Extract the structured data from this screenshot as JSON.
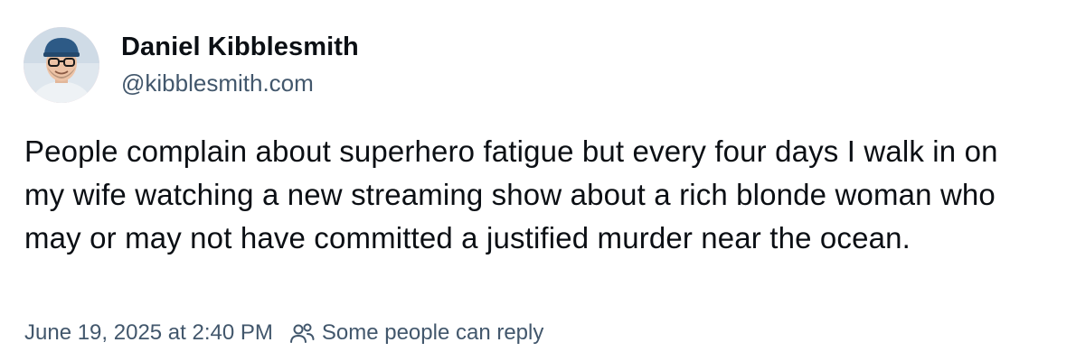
{
  "author": {
    "display_name": "Daniel Kibblesmith",
    "handle": "@kibblesmith.com"
  },
  "post": {
    "text": "People complain about superhero fatigue but every four days I walk in on my wife watching a new streaming show about a rich blonde woman who may or may not have committed a justified murder near the ocean.",
    "timestamp": "June 19, 2025 at 2:40 PM",
    "reply_setting": "Some people can reply"
  },
  "icons": {
    "reply_setting": "people-icon"
  },
  "colors": {
    "text": "#0b0f14",
    "muted": "#42576c",
    "background": "#ffffff"
  }
}
